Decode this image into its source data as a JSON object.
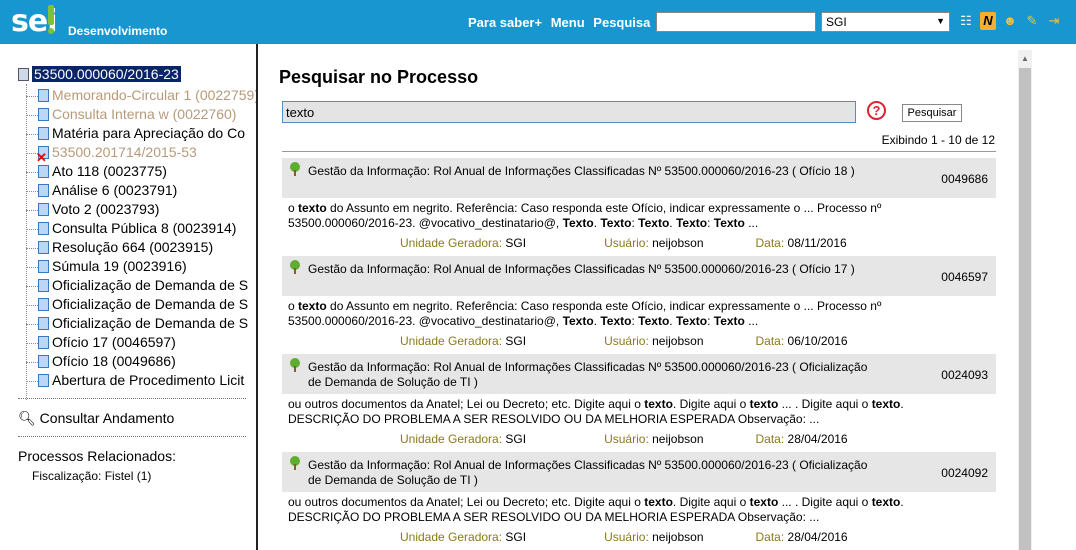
{
  "header": {
    "logo": "sei",
    "environment": "Desenvolvimento",
    "links": [
      "Para saber+",
      "Menu",
      "Pesquisa"
    ],
    "search_value": "",
    "unit_select": "SGI",
    "icons": [
      "list-icon",
      "news-icon",
      "user-icon",
      "tools-icon",
      "exit-icon"
    ]
  },
  "tree": {
    "root": "53500.000060/2016-23",
    "items": [
      {
        "label": "Memorando-Circular 1 (0022759)",
        "muted": true
      },
      {
        "label": "Consulta Interna w (0022760)",
        "muted": true
      },
      {
        "label": "Matéria para Apreciação do Co",
        "muted": false
      },
      {
        "label": "53500.201714/2015-53",
        "muted": true,
        "cancelled": true
      },
      {
        "label": "Ato 118 (0023775)",
        "muted": false
      },
      {
        "label": "Análise 6 (0023791)",
        "muted": false
      },
      {
        "label": "Voto 2 (0023793)",
        "muted": false
      },
      {
        "label": "Consulta Pública 8 (0023914)",
        "muted": false
      },
      {
        "label": "Resolução 664 (0023915)",
        "muted": false
      },
      {
        "label": "Súmula 19 (0023916)",
        "muted": false
      },
      {
        "label": "Oficialização de Demanda de S",
        "muted": false
      },
      {
        "label": "Oficialização de Demanda de S",
        "muted": false
      },
      {
        "label": "Oficialização de Demanda de S",
        "muted": false
      },
      {
        "label": "Ofício 17 (0046597)",
        "muted": false
      },
      {
        "label": "Ofício 18 (0049686)",
        "muted": false
      },
      {
        "label": "Abertura de Procedimento Licit",
        "muted": false
      }
    ],
    "consult_label": "Consultar Andamento",
    "related_label": "Processos Relacionados:",
    "related_item": "Fiscalização: Fistel (1)"
  },
  "main": {
    "title": "Pesquisar no Processo",
    "search_value": "texto",
    "search_button": "Pesquisar",
    "showing": "Exibindo 1 - 10 de 12",
    "label_unit": "Unidade Geradora:",
    "label_user": "Usuário:",
    "label_date": "Data:",
    "results": [
      {
        "title": "Gestão da Informação: Rol Anual de Informações Classificadas Nº 53500.000060/2016-23 ( Ofício 18 )",
        "number": "0049686",
        "body": "o texto do Assunto em negrito. Referência: Caso responda este Ofício, indicar expressamente o  ...  Processo nº 53500.000060/2016-23. @vocativo_destinatario@, Texto. Texto: Texto. Texto: Texto  ...",
        "unit": "SGI",
        "user": "neijobson",
        "date": "08/11/2016"
      },
      {
        "title": "Gestão da Informação: Rol Anual de Informações Classificadas Nº 53500.000060/2016-23 ( Ofício 17 )",
        "number": "0046597",
        "body": "o texto do Assunto em negrito. Referência: Caso responda este Ofício, indicar expressamente o  ...  Processo nº 53500.000060/2016-23. @vocativo_destinatario@, Texto. Texto: Texto. Texto: Texto  ...",
        "unit": "SGI",
        "user": "neijobson",
        "date": "06/10/2016"
      },
      {
        "title": "Gestão da Informação: Rol Anual de Informações Classificadas Nº 53500.000060/2016-23 ( Oficialização de Demanda de Solução de TI )",
        "number": "0024093",
        "body": "ou outros documentos da Anatel; Lei ou Decreto; etc. Digite aqui o texto. Digite aqui o texto  ...  . Digite aqui o texto. DESCRIÇÃO DO PROBLEMA A SER RESOLVIDO OU DA MELHORIA ESPERADA Observação:  ...",
        "unit": "SGI",
        "user": "neijobson",
        "date": "28/04/2016"
      },
      {
        "title": "Gestão da Informação: Rol Anual de Informações Classificadas Nº 53500.000060/2016-23 ( Oficialização de Demanda de Solução de TI )",
        "number": "0024092",
        "body": "ou outros documentos da Anatel; Lei ou Decreto; etc. Digite aqui o texto. Digite aqui o texto  ...  . Digite aqui o texto. DESCRIÇÃO DO PROBLEMA A SER RESOLVIDO OU DA MELHORIA ESPERADA Observação:  ...",
        "unit": "SGI",
        "user": "neijobson",
        "date": "28/04/2016"
      }
    ]
  }
}
